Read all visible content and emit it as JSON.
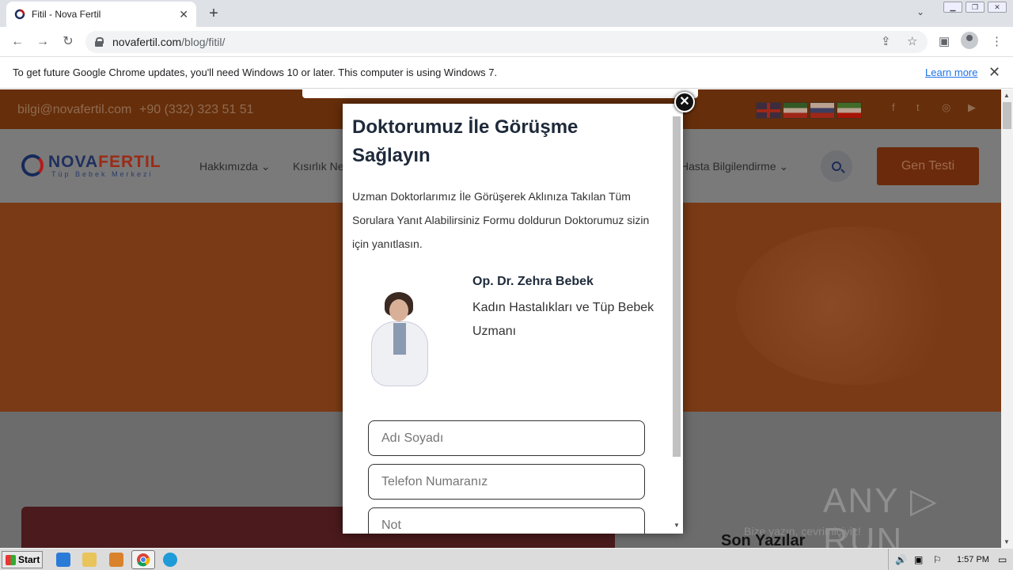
{
  "browser": {
    "tab_title": "Fitil - Nova Fertil",
    "url_domain": "novafertil.com",
    "url_path": "/blog/fitil/",
    "new_tab": "+",
    "tab_close": "✕",
    "tab_menu": "⌄"
  },
  "infobar": {
    "message": "To get future Google Chrome updates, you'll need Windows 10 or later. This computer is using Windows 7.",
    "learn_more": "Learn more",
    "close": "✕"
  },
  "site": {
    "email": "bilgi@novafertil.com",
    "phone": "+90 (332) 323 51 51",
    "logo_word_a": "NOVA",
    "logo_word_b": "FERTIL",
    "logo_sub": "Tüp Bebek Merkezi",
    "nav": [
      "Hakkımızda ⌄",
      "Kısırlık Ne",
      "Hasta Bilgilendirme ⌄"
    ],
    "cta": "Gen Testi",
    "sidebar_heading": "Son Yazılar",
    "chat_text": "Bize yazın, çevrimiçiyiz!",
    "social": [
      "f",
      "t",
      "◎",
      "▶"
    ]
  },
  "modal": {
    "title": "Doktorumuz İle Görüşme Sağlayın",
    "description": "Uzman Doktorlarımız İle Görüşerek Aklınıza Takılan Tüm Sorulara Yanıt Alabilirsiniz Formu doldurun Doktorumuz sizin için yanıtlasın.",
    "doctor_name": "Op. Dr. Zehra Bebek",
    "doctor_title": "Kadın Hastalıkları ve Tüp Bebek Uzmanı",
    "name_placeholder": "Adı Soyadı",
    "phone_placeholder": "Telefon Numaranız",
    "note_placeholder": "Not",
    "close": "✕"
  },
  "watermark": "ANY ▷ RUN",
  "taskbar": {
    "start": "Start",
    "clock": "1:57 PM"
  }
}
